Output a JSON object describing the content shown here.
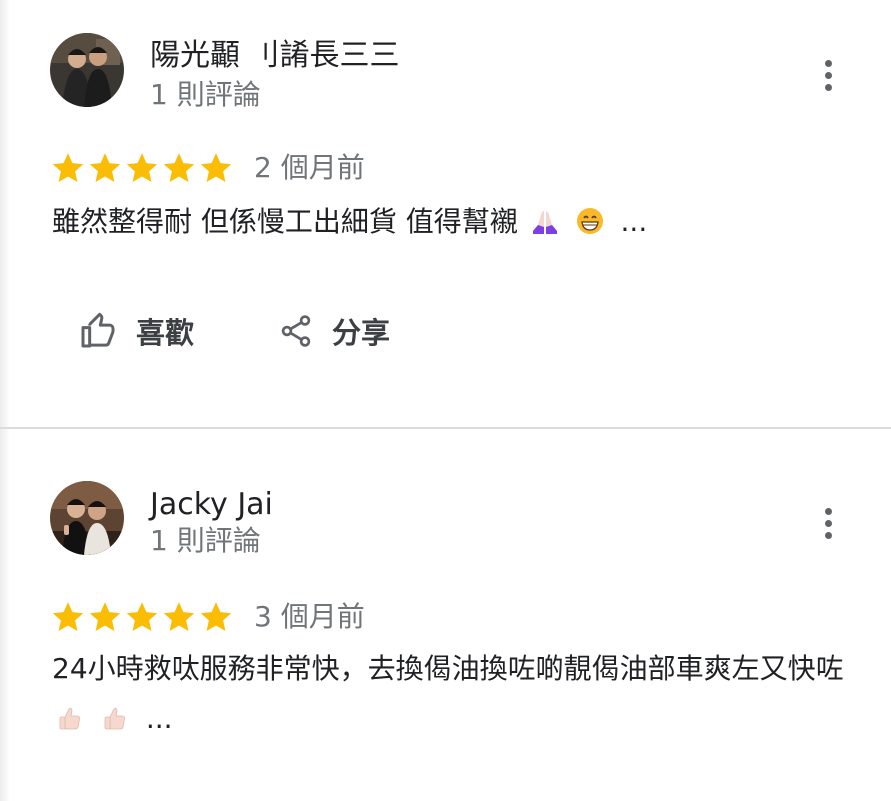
{
  "colors": {
    "star": "#fbbc04",
    "text_primary": "#202124",
    "text_secondary": "#70757a",
    "icon": "#5f6368",
    "divider": "#dadce0"
  },
  "reviews": [
    {
      "author": "陽光顳 刂誵長三三",
      "review_count": "1 則評論",
      "rating": 5,
      "date": "2 個月前",
      "text": "雖然整得耐 但係慢工出細貨 值得幫襯",
      "emojis": [
        "folded-hands-icon",
        "grinning-face-icon"
      ],
      "ellipsis": "...",
      "actions": {
        "like_label": "喜歡",
        "share_label": "分享"
      }
    },
    {
      "author": "Jacky Jai",
      "review_count": "1 則評論",
      "rating": 5,
      "date": "3 個月前",
      "text": "24小時救呔服務非常快，去換偈油換咗啲靚偈油部車爽左又快咗",
      "emojis": [
        "thumbs-up-icon",
        "thumbs-up-icon"
      ],
      "ellipsis": "..."
    }
  ]
}
